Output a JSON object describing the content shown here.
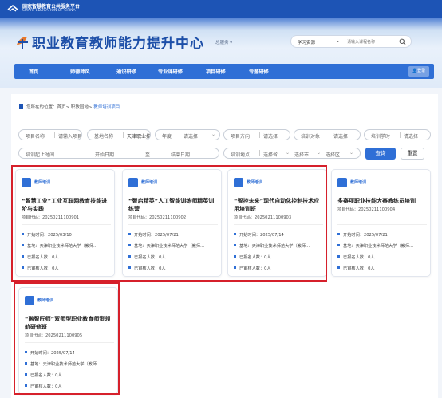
{
  "org": {
    "name_cn": "国家智慧教育公共服务平台",
    "name_en": "SMART EDUCATION OF CHINA"
  },
  "brand": {
    "title": "职业教育教师能力提升中心",
    "region": "总服务 ▾"
  },
  "search": {
    "type": "学习资源",
    "placeholder": "请输入课程名称"
  },
  "nav": {
    "items": [
      "首页",
      "师德师风",
      "通识研修",
      "专业课研修",
      "项目研修",
      "专题研修"
    ],
    "login": "登录"
  },
  "breadcrumb": {
    "prefix": "您所在的位置：",
    "path": "首页> 职教园地> ",
    "current": "教师培训项目"
  },
  "filters": {
    "project_name": {
      "label": "项目名称",
      "placeholder": "请输入项目名称"
    },
    "base_name": {
      "label": "基地名称",
      "value": "天津职业技术师范大学"
    },
    "year": {
      "label": "年度",
      "value": "请选择"
    },
    "direction": {
      "label": "项目方向",
      "value": "请选择"
    },
    "target": {
      "label": "培训对象",
      "value": "请选择"
    },
    "hours": {
      "label": "培训学时",
      "value": "请选择"
    },
    "period": {
      "label": "培训起止时间",
      "start": "开始日期",
      "to": "至",
      "end": "结束日期"
    },
    "location": {
      "label": "培训地点",
      "province": "选择省",
      "city": "选择市",
      "district": "选择区"
    },
    "search_btn": "查询",
    "reset_btn": "重置"
  },
  "cards": [
    {
      "badge": "教师培训",
      "title": "“智慧工业”工业互联网教育技能进阶与实践",
      "code": "项目代码：20250211100901",
      "start": "开始时间：2025/03/10",
      "base": "基地：天津职业技术师范大学（教师…",
      "enrolled": "已报名人数：0人",
      "reviewed": "已审核人数：0人"
    },
    {
      "badge": "教师培训",
      "title": "“智启精英”人工智能训练师精英训练营",
      "code": "项目代码：20250211100902",
      "start": "开始时间：2025/07/21",
      "base": "基地：天津职业技术师范大学（教师…",
      "enrolled": "已报名人数：0人",
      "reviewed": "已审核人数：0人"
    },
    {
      "badge": "教师培训",
      "title": "“智控未来”现代自动化控制技术应用培训班",
      "code": "项目代码：20250211100903",
      "start": "开始时间：2025/07/14",
      "base": "基地：天津职业技术师范大学（教师…",
      "enrolled": "已报名人数：0人",
      "reviewed": "已审核人数：0人"
    },
    {
      "badge": "教师培训",
      "title": "多赛项职业技能大赛教练员培训",
      "code": "项目代码：20250211100904",
      "start": "开始时间：2025/07/21",
      "base": "基地：天津职业技术师范大学（教师…",
      "enrolled": "已报名人数：0人",
      "reviewed": "已审核人数：0人"
    },
    {
      "badge": "教师培训",
      "title": "“融智匠师”双师型职业教育师资领航研修班",
      "code": "项目代码：20250211100905",
      "start": "开始时间：2025/07/14",
      "base": "基地：天津职业技术师范大学（教师…",
      "enrolled": "已报名人数：0人",
      "reviewed": "已审核人数：0人"
    }
  ],
  "colors": {
    "primary": "#2f6fd6",
    "dark_blue": "#1d54b5",
    "highlight_box": "#d6202b"
  },
  "icons": {
    "org_logo": "education-logo-icon",
    "brand_logo": "leaf-logo-icon",
    "search": "search-icon",
    "badge": "teacher-training-icon",
    "user": "user-icon"
  }
}
